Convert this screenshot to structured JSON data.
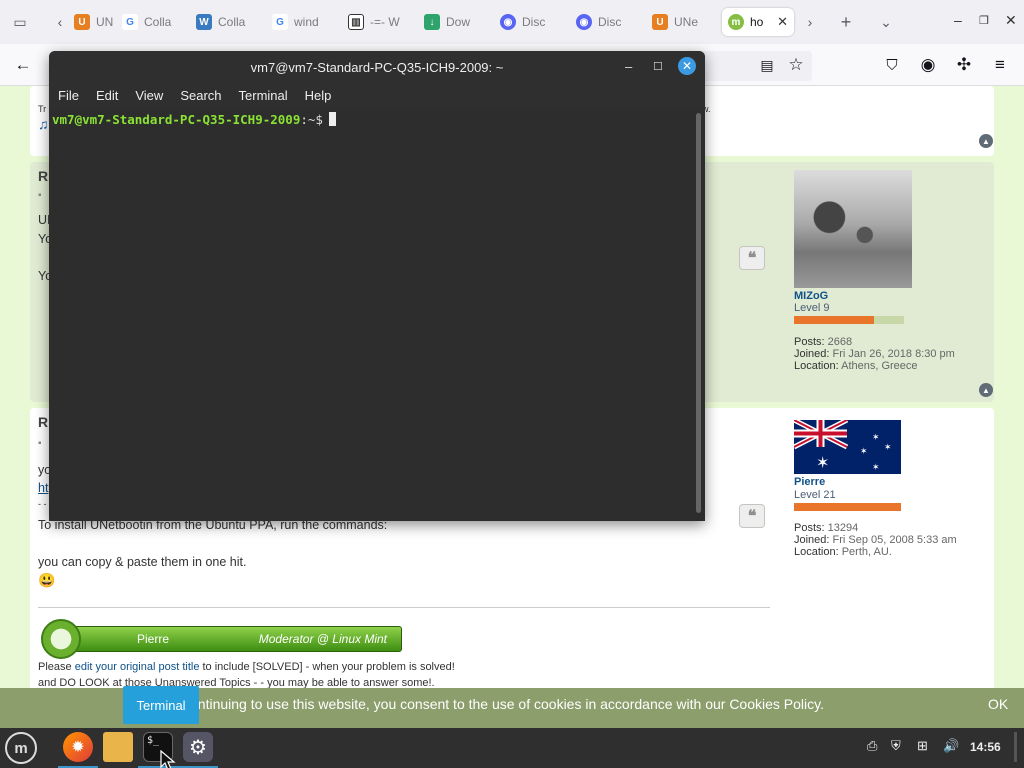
{
  "browser": {
    "tabs": [
      {
        "label": "UN",
        "favicon": "unetbootin-icon"
      },
      {
        "label": "Colla",
        "favicon": "google-icon"
      },
      {
        "label": "Colla",
        "favicon": "wikimedia-icon"
      },
      {
        "label": "wind",
        "favicon": "google-icon"
      },
      {
        "label": "-=- W",
        "favicon": "library-icon"
      },
      {
        "label": "Dow",
        "favicon": "download-icon"
      },
      {
        "label": "Disc",
        "favicon": "discord-icon"
      },
      {
        "label": "Disc",
        "favicon": "discord-icon"
      },
      {
        "label": "UNe",
        "favicon": "unetbootin-icon"
      },
      {
        "label": "ho",
        "favicon": "linuxmint-icon",
        "active": true
      }
    ]
  },
  "forum": {
    "post1": {
      "line1": "Tr",
      "tail_text": "w."
    },
    "post2": {
      "title": "R",
      "lines": [
        "UI",
        "Yo",
        "Yo"
      ],
      "author": {
        "name": "MIZoG",
        "rank": "Level 9",
        "posts_label": "Posts:",
        "posts": "2668",
        "joined_label": "Joined:",
        "joined": "Fri Jan 26, 2018 8:30 pm",
        "location_label": "Location:",
        "location": "Athens, Greece"
      }
    },
    "post3": {
      "title": "R",
      "lines": [
        "yo",
        "ht",
        "- -"
      ],
      "install_text": "To install UNetbootin from the Ubuntu PPA, run the commands:",
      "copy_text": "you can copy & paste them in one hit.",
      "emoji": "😃",
      "signature": {
        "name": "Pierre",
        "role": "Moderator @ Linux Mint"
      },
      "footer_line1_prefix": "Please ",
      "footer_link": "edit your original post title",
      "footer_line1_suffix": " to include [SOLVED] - when your problem is solved!",
      "footer_line2": "and DO LOOK at those Unanswered Topics - - you may be able to answer some!.",
      "author": {
        "name": "Pierre",
        "rank": "Level 21",
        "posts_label": "Posts:",
        "posts": "13294",
        "joined_label": "Joined:",
        "joined": "Fri Sep 05, 2008 5:33 am",
        "location_label": "Location:",
        "location": "Perth, AU."
      }
    },
    "cookie_text": "ontinuing to use this website, you consent to the use of cookies in accordance with our Cookies Policy.",
    "cookie_ok": "OK"
  },
  "terminal": {
    "title": "vm7@vm7-Standard-PC-Q35-ICH9-2009: ~",
    "menu": [
      "File",
      "Edit",
      "View",
      "Search",
      "Terminal",
      "Help"
    ],
    "prompt_user": "vm7@vm7-Standard-PC-Q35-ICH9-2009",
    "prompt_path": ":~$"
  },
  "taskbar": {
    "tooltip": "Terminal",
    "clock": "14:56"
  },
  "colors": {
    "terminal_bg": "#2d2d2d",
    "prompt_green": "#8ae234",
    "cookie_bar": "#8b9e6b",
    "tooltip_blue": "#26a0da"
  }
}
